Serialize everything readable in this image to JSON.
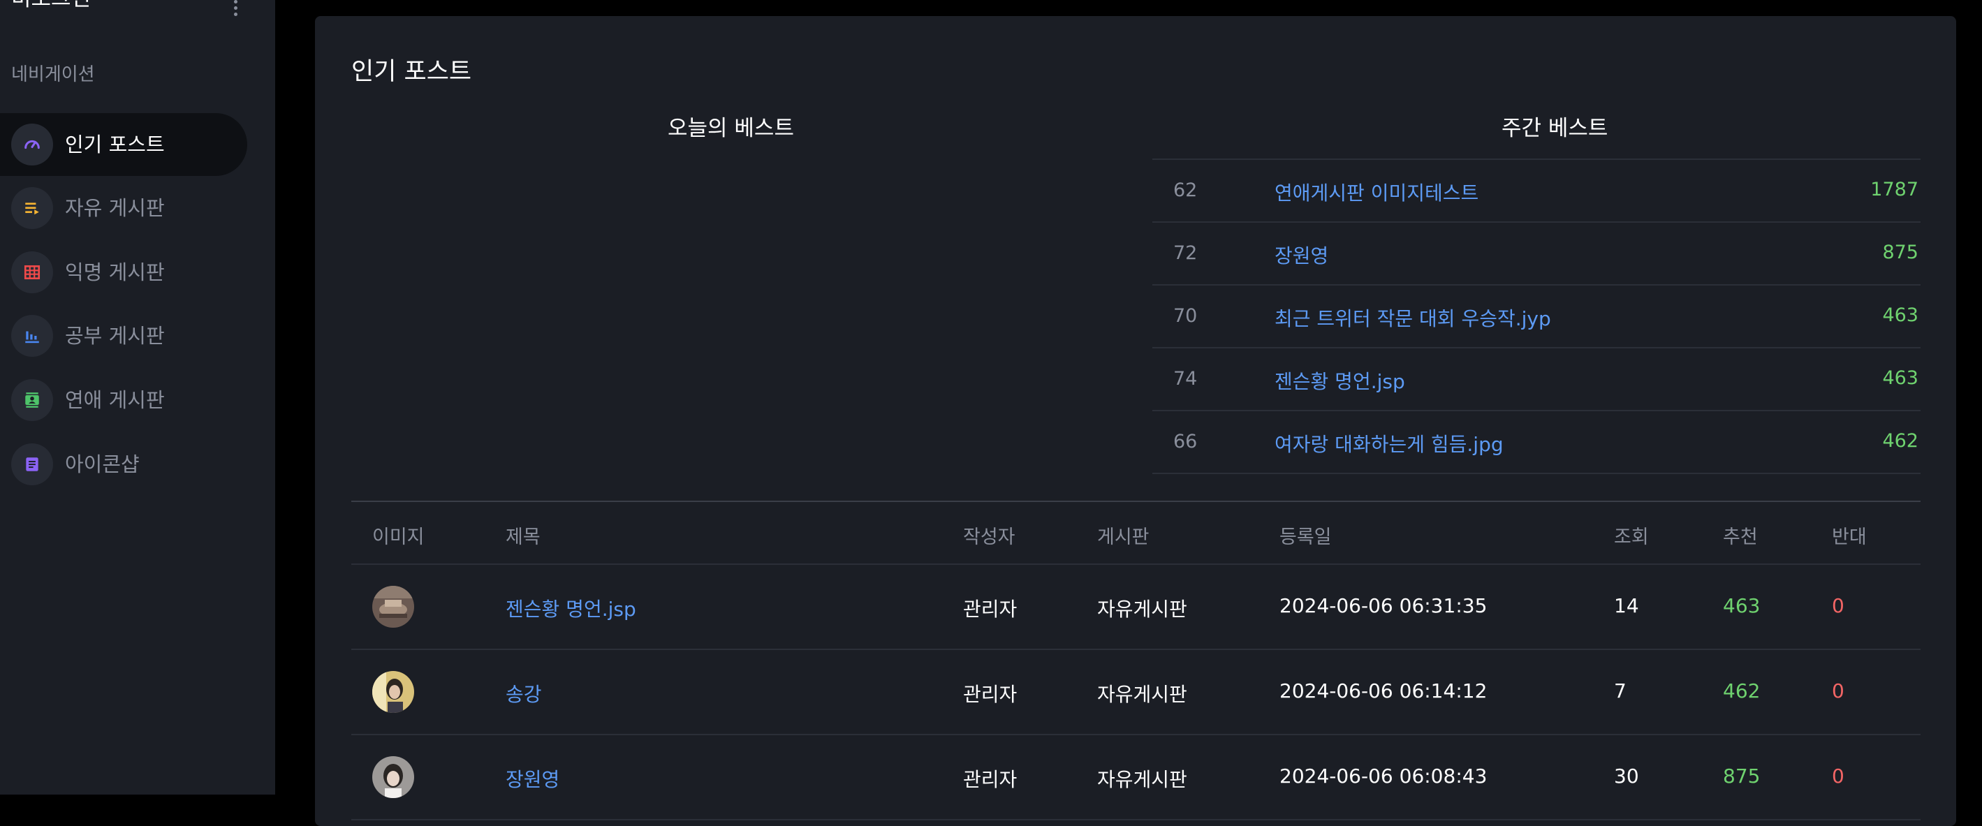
{
  "app": {
    "brand_title": "비로그인"
  },
  "sidebar": {
    "heading": "네비게이션",
    "items": [
      {
        "label": "인기 포스트",
        "icon": "speedometer-icon",
        "color": "#8b63f5",
        "active": true
      },
      {
        "label": "자유 게시판",
        "icon": "list-icon",
        "color": "#f5b433",
        "active": false
      },
      {
        "label": "익명 게시판",
        "icon": "grid-icon",
        "color": "#f04a4a",
        "active": false
      },
      {
        "label": "공부 게시판",
        "icon": "bar-chart-icon",
        "color": "#4a86f0",
        "active": false
      },
      {
        "label": "연애 게시판",
        "icon": "contact-card-icon",
        "color": "#4ec46a",
        "active": false
      },
      {
        "label": "아이콘샵",
        "icon": "document-icon",
        "color": "#8b63f5",
        "active": false
      }
    ]
  },
  "main": {
    "title": "인기 포스트",
    "today_best": {
      "title": "오늘의 베스트"
    },
    "weekly_best": {
      "title": "주간 베스트",
      "rows": [
        {
          "rank": "62",
          "title": "연애게시판 이미지테스트",
          "score": "1787"
        },
        {
          "rank": "72",
          "title": "장원영",
          "score": "875"
        },
        {
          "rank": "70",
          "title": "최근 트위터 작문 대회 우승작.jyp",
          "score": "463"
        },
        {
          "rank": "74",
          "title": "젠슨황 명언.jsp",
          "score": "463"
        },
        {
          "rank": "66",
          "title": "여자랑 대화하는게 힘듬.jpg",
          "score": "462"
        }
      ]
    },
    "list": {
      "headers": {
        "image": "이미지",
        "title": "제목",
        "author": "작성자",
        "board": "게시판",
        "date": "등록일",
        "views": "조회",
        "up": "추천",
        "down": "반대"
      },
      "rows": [
        {
          "title": "젠슨황 명언.jsp",
          "author": "관리자",
          "board": "자유게시판",
          "date": "2024-06-06 06:31:35",
          "views": "14",
          "up": "463",
          "down": "0"
        },
        {
          "title": "송강",
          "author": "관리자",
          "board": "자유게시판",
          "date": "2024-06-06 06:14:12",
          "views": "7",
          "up": "462",
          "down": "0"
        },
        {
          "title": "장원영",
          "author": "관리자",
          "board": "자유게시판",
          "date": "2024-06-06 06:08:43",
          "views": "30",
          "up": "875",
          "down": "0"
        }
      ]
    }
  },
  "colors": {
    "link": "#5d9bf5",
    "upvote": "#6fd26f",
    "downvote": "#f26565",
    "panel": "#1b1e25"
  }
}
